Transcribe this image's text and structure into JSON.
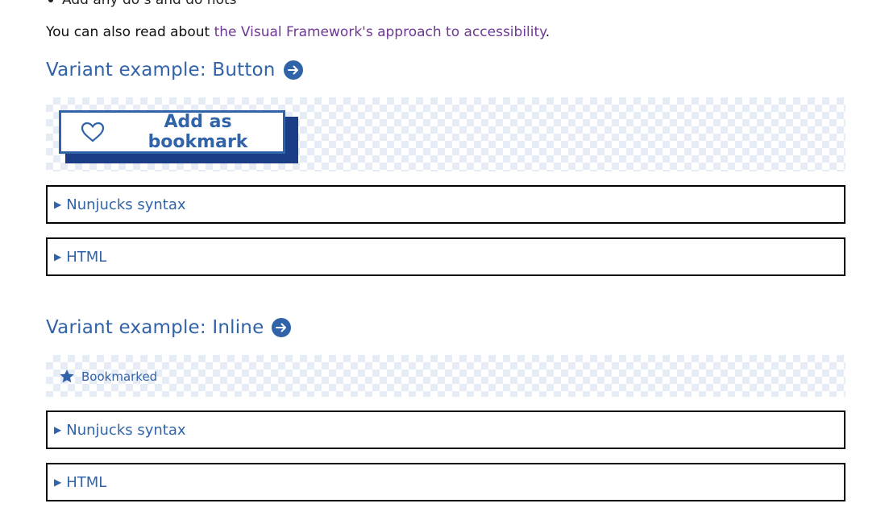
{
  "intro": {
    "bullet_text": "Add any do’s and do nots",
    "prefix": "You can also read about ",
    "link_text": "the Visual Framework's approach to accessibility",
    "suffix": "."
  },
  "sections": [
    {
      "heading": "Variant example: Button",
      "example": {
        "button_label": "Add as bookmark",
        "icon": "heart-icon"
      },
      "details": [
        {
          "summary": "Nunjucks syntax"
        },
        {
          "summary": "HTML"
        }
      ]
    },
    {
      "heading": "Variant example: Inline",
      "example": {
        "inline_label": "Bookmarked",
        "icon": "star-icon"
      },
      "details": [
        {
          "summary": "Nunjucks syntax"
        },
        {
          "summary": "HTML"
        }
      ]
    }
  ],
  "colors": {
    "accent": "#3163a8",
    "link": "#6f3795",
    "shadow": "#1a3e85",
    "checker": "#e6ecf6"
  }
}
